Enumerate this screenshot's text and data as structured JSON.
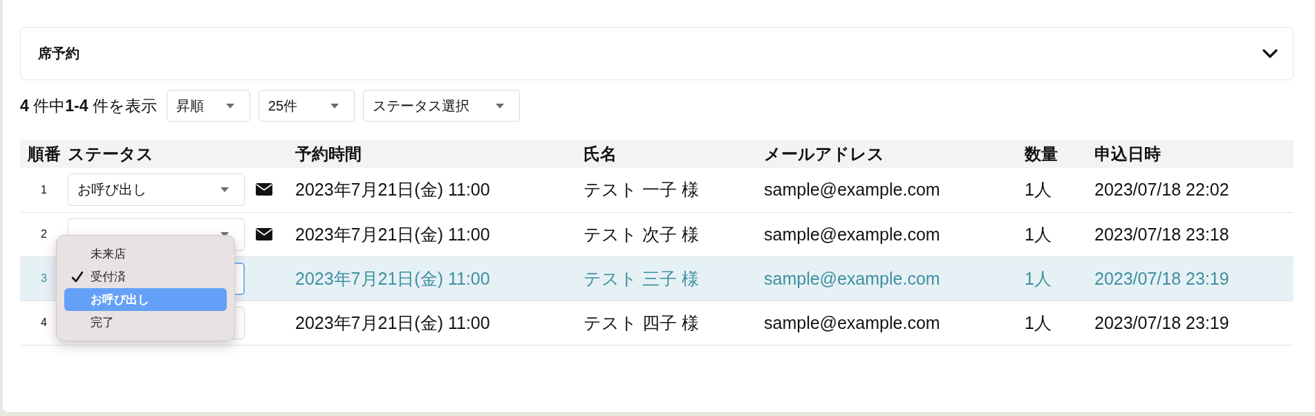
{
  "section": {
    "title": "席予約",
    "expanded": true
  },
  "toolbar": {
    "summary": "**4** 件中**1-4** 件を表示",
    "selects": [
      {
        "label": "昇順"
      },
      {
        "label": "25件"
      },
      {
        "label": "ステータス選択"
      }
    ]
  },
  "table": {
    "columns": [
      "順番",
      "ステータス",
      "予約時間",
      "氏名",
      "メールアドレス",
      "数量",
      "申込日時"
    ],
    "rows": [
      {
        "number": "1",
        "status": "お呼び出し",
        "mail": true,
        "time": "2023年7月21日(金) 11:00",
        "name": "テスト 一子 様",
        "email": "sample@example.com",
        "quantity": "1人",
        "applied": "2023/07/18 22:02",
        "selected": false
      },
      {
        "number": "2",
        "mail": true,
        "time": "2023年7月21日(金) 11:00",
        "name": "テスト 次子 様",
        "email": "sample@example.com",
        "quantity": "1人",
        "applied": "2023/07/18 23:18",
        "selected": false
      },
      {
        "number": "3",
        "mail": false,
        "time": "2023年7月21日(金) 11:00",
        "name": "テスト 三子 様",
        "email": "sample@example.com",
        "quantity": "1人",
        "applied": "2023/07/18 23:19",
        "selected": true
      },
      {
        "number": "4",
        "mail": false,
        "time": "2023年7月21日(金) 11:00",
        "name": "テスト 四子 様",
        "email": "sample@example.com",
        "quantity": "1人",
        "applied": "2023/07/18 23:19",
        "selected": false
      }
    ]
  },
  "status_menu": {
    "items": [
      {
        "label": "未来店",
        "checked": false,
        "highlighted": false
      },
      {
        "label": "受付済",
        "checked": true,
        "highlighted": false
      },
      {
        "label": "お呼び出し",
        "checked": false,
        "highlighted": true
      },
      {
        "label": "完了",
        "checked": false,
        "highlighted": false
      }
    ]
  }
}
